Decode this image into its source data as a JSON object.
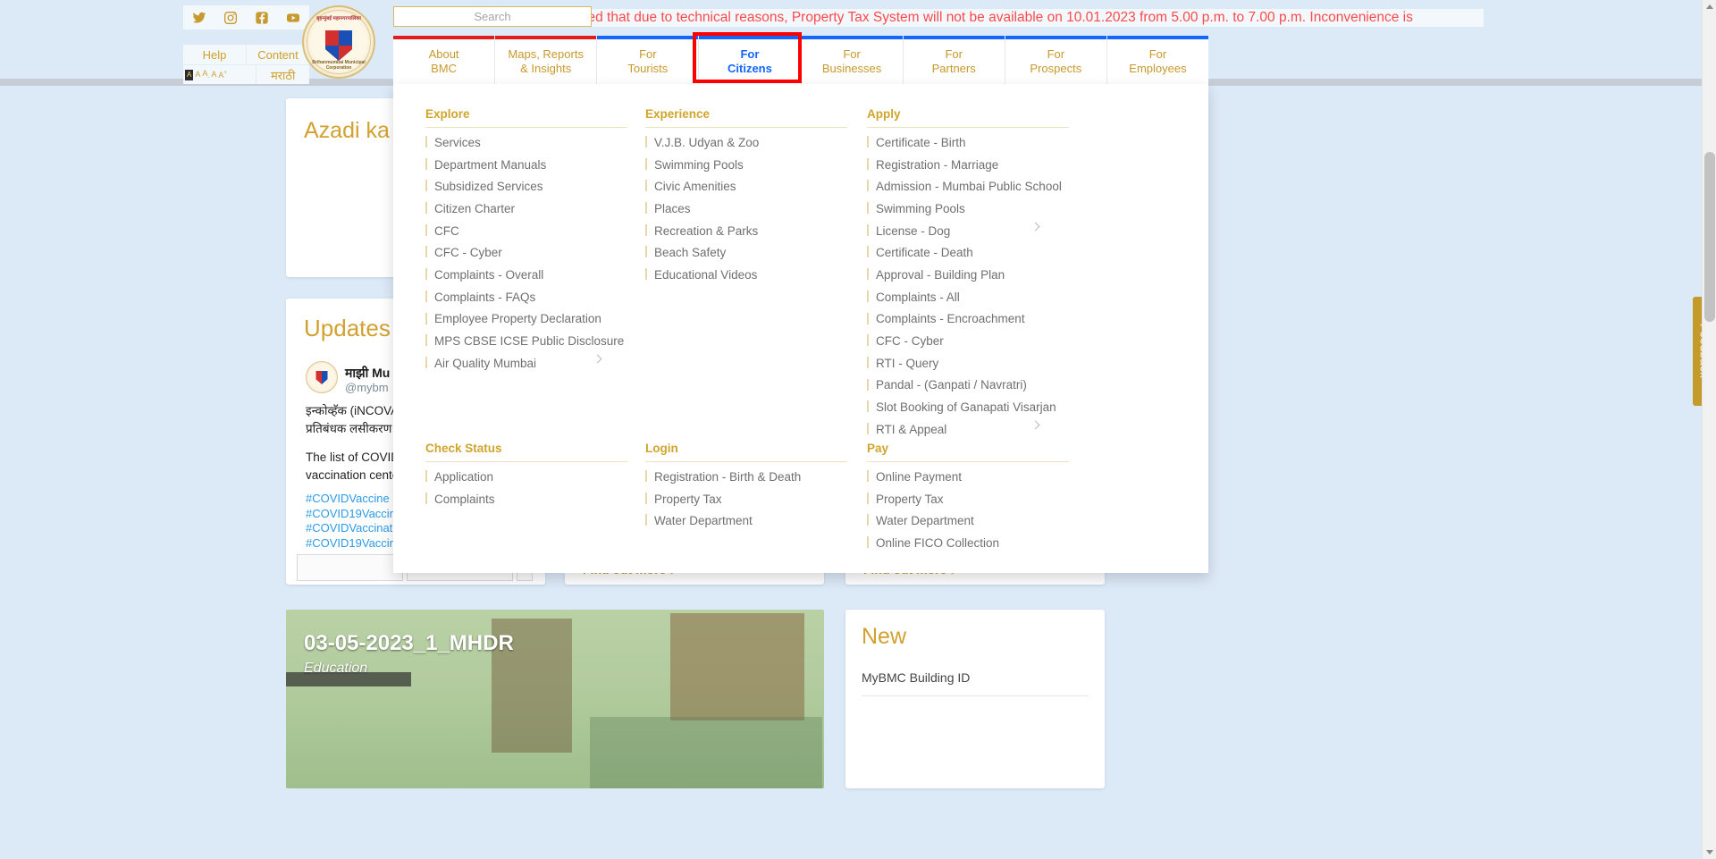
{
  "site": {
    "ticker": "…ed that due to technical reasons, Property Tax System will not be available on 10.01.2023 from 5.00 p.m. to 7.00 p.m. Inconvenience is",
    "emblem_top": "बृहन्मुंबई महानगरपालिका",
    "emblem_bottom": "Brihanmumbai Municipal Corporation"
  },
  "social": [
    {
      "name": "twitter-icon",
      "glyph": "twitter"
    },
    {
      "name": "instagram-icon",
      "glyph": "instagram"
    },
    {
      "name": "facebook-icon",
      "glyph": "facebook"
    },
    {
      "name": "youtube-icon",
      "glyph": "youtube"
    }
  ],
  "utility": {
    "help": "Help",
    "content": "Content",
    "language": "मराठी",
    "font_sizes": [
      "A",
      "A",
      "A",
      "A",
      "A"
    ],
    "font_size_selected_index": 0
  },
  "search": {
    "placeholder": "Search",
    "value": ""
  },
  "nav": {
    "items": [
      {
        "label_line1": "About",
        "label_line2": "BMC",
        "bar_color": "#e31b1b",
        "active": false
      },
      {
        "label_line1": "Maps, Reports",
        "label_line2": "& Insights",
        "bar_color": "#e31b1b",
        "active": false
      },
      {
        "label_line1": "For",
        "label_line2": "Tourists",
        "bar_color": "#1565ff",
        "active": false
      },
      {
        "label_line1": "For",
        "label_line2": "Citizens",
        "bar_color": "#1565ff",
        "active": true
      },
      {
        "label_line1": "For",
        "label_line2": "Businesses",
        "bar_color": "#1565ff",
        "active": false
      },
      {
        "label_line1": "For",
        "label_line2": "Partners",
        "bar_color": "#1565ff",
        "active": false
      },
      {
        "label_line1": "For",
        "label_line2": "Prospects",
        "bar_color": "#1565ff",
        "active": false
      },
      {
        "label_line1": "For",
        "label_line2": "Employees",
        "bar_color": "#1565ff",
        "active": false
      }
    ],
    "highlighted_item": "For Citizens"
  },
  "megamenu": {
    "columns": [
      {
        "heading": "Explore",
        "items": [
          {
            "label": "Services",
            "chevron": false
          },
          {
            "label": "Department Manuals",
            "chevron": false
          },
          {
            "label": "Subsidized Services",
            "chevron": false
          },
          {
            "label": "Citizen Charter",
            "chevron": false
          },
          {
            "label": "CFC",
            "chevron": false
          },
          {
            "label": "CFC - Cyber",
            "chevron": false
          },
          {
            "label": "Complaints - Overall",
            "chevron": false
          },
          {
            "label": "Complaints - FAQs",
            "chevron": false
          },
          {
            "label": "Employee Property Declaration",
            "chevron": false
          },
          {
            "label": "MPS CBSE ICSE Public Disclosure",
            "chevron": false
          },
          {
            "label": "Air Quality Mumbai",
            "chevron": true
          }
        ]
      },
      {
        "heading": "Experience",
        "items": [
          {
            "label": "V.J.B. Udyan & Zoo",
            "chevron": false
          },
          {
            "label": "Swimming Pools",
            "chevron": false
          },
          {
            "label": "Civic Amenities",
            "chevron": false
          },
          {
            "label": "Places",
            "chevron": false
          },
          {
            "label": "Recreation & Parks",
            "chevron": false
          },
          {
            "label": "Beach Safety",
            "chevron": false
          },
          {
            "label": "Educational Videos",
            "chevron": false
          }
        ]
      },
      {
        "heading": "Apply",
        "items": [
          {
            "label": "Certificate - Birth",
            "chevron": false
          },
          {
            "label": "Registration - Marriage",
            "chevron": false
          },
          {
            "label": "Admission - Mumbai Public School",
            "chevron": false
          },
          {
            "label": "Swimming Pools",
            "chevron": false
          },
          {
            "label": "License - Dog",
            "chevron": true
          },
          {
            "label": "Certificate - Death",
            "chevron": false
          },
          {
            "label": "Approval - Building Plan",
            "chevron": false
          },
          {
            "label": "Complaints - All",
            "chevron": false
          },
          {
            "label": "Complaints - Encroachment",
            "chevron": false
          },
          {
            "label": "CFC - Cyber",
            "chevron": false
          },
          {
            "label": "RTI - Query",
            "chevron": false
          },
          {
            "label": "Pandal - (Ganpati / Navratri)",
            "chevron": false
          },
          {
            "label": "Slot Booking of Ganapati Visarjan",
            "chevron": false
          },
          {
            "label": "RTI & Appeal",
            "chevron": true
          }
        ]
      }
    ],
    "columns_bottom": [
      {
        "heading": "Check Status",
        "items": [
          {
            "label": "Application",
            "chevron": false
          },
          {
            "label": "Complaints",
            "chevron": false
          }
        ]
      },
      {
        "heading": "Login",
        "items": [
          {
            "label": "Registration - Birth & Death",
            "chevron": false
          },
          {
            "label": "Property Tax",
            "chevron": false
          },
          {
            "label": "Water Department",
            "chevron": false
          }
        ]
      },
      {
        "heading": "Pay",
        "items": [
          {
            "label": "Online Payment",
            "chevron": false
          },
          {
            "label": "Property Tax",
            "chevron": false
          },
          {
            "label": "Water Department",
            "chevron": false
          },
          {
            "label": "Online FICO Collection",
            "chevron": false
          }
        ]
      }
    ]
  },
  "background": {
    "azadi_title": "Azadi ka A",
    "updates_title": "Updates",
    "tweet": {
      "name": "माझी Mu",
      "handle": "@mybm",
      "line1": "इन्कोव्हॅक (iNCOVA",
      "line2": "प्रतिबंधक लसीकरण",
      "body1": "The list of COVID",
      "body2": "vaccination cente",
      "tags": [
        "#COVIDVaccine",
        "#COVID19Vaccine",
        "#COVIDVaccinatio",
        "#COVID19Vaccina"
      ]
    },
    "find_out_more": "Find out more",
    "photo": {
      "title": "03-05-2023_1_MHDR",
      "subtitle": "Education"
    },
    "new_card": {
      "title": "New",
      "item": "MyBMC Building ID"
    }
  },
  "feedback": {
    "label": "Feedback"
  },
  "colors": {
    "gold": "#c8992c",
    "gold_heading": "#d0a52c",
    "blue_accent": "#1565ff",
    "red_accent": "#e31b1b",
    "page_bg": "#dce9f7",
    "ticker_text": "#fa4a4a",
    "highlight_box": "#ff0000"
  }
}
